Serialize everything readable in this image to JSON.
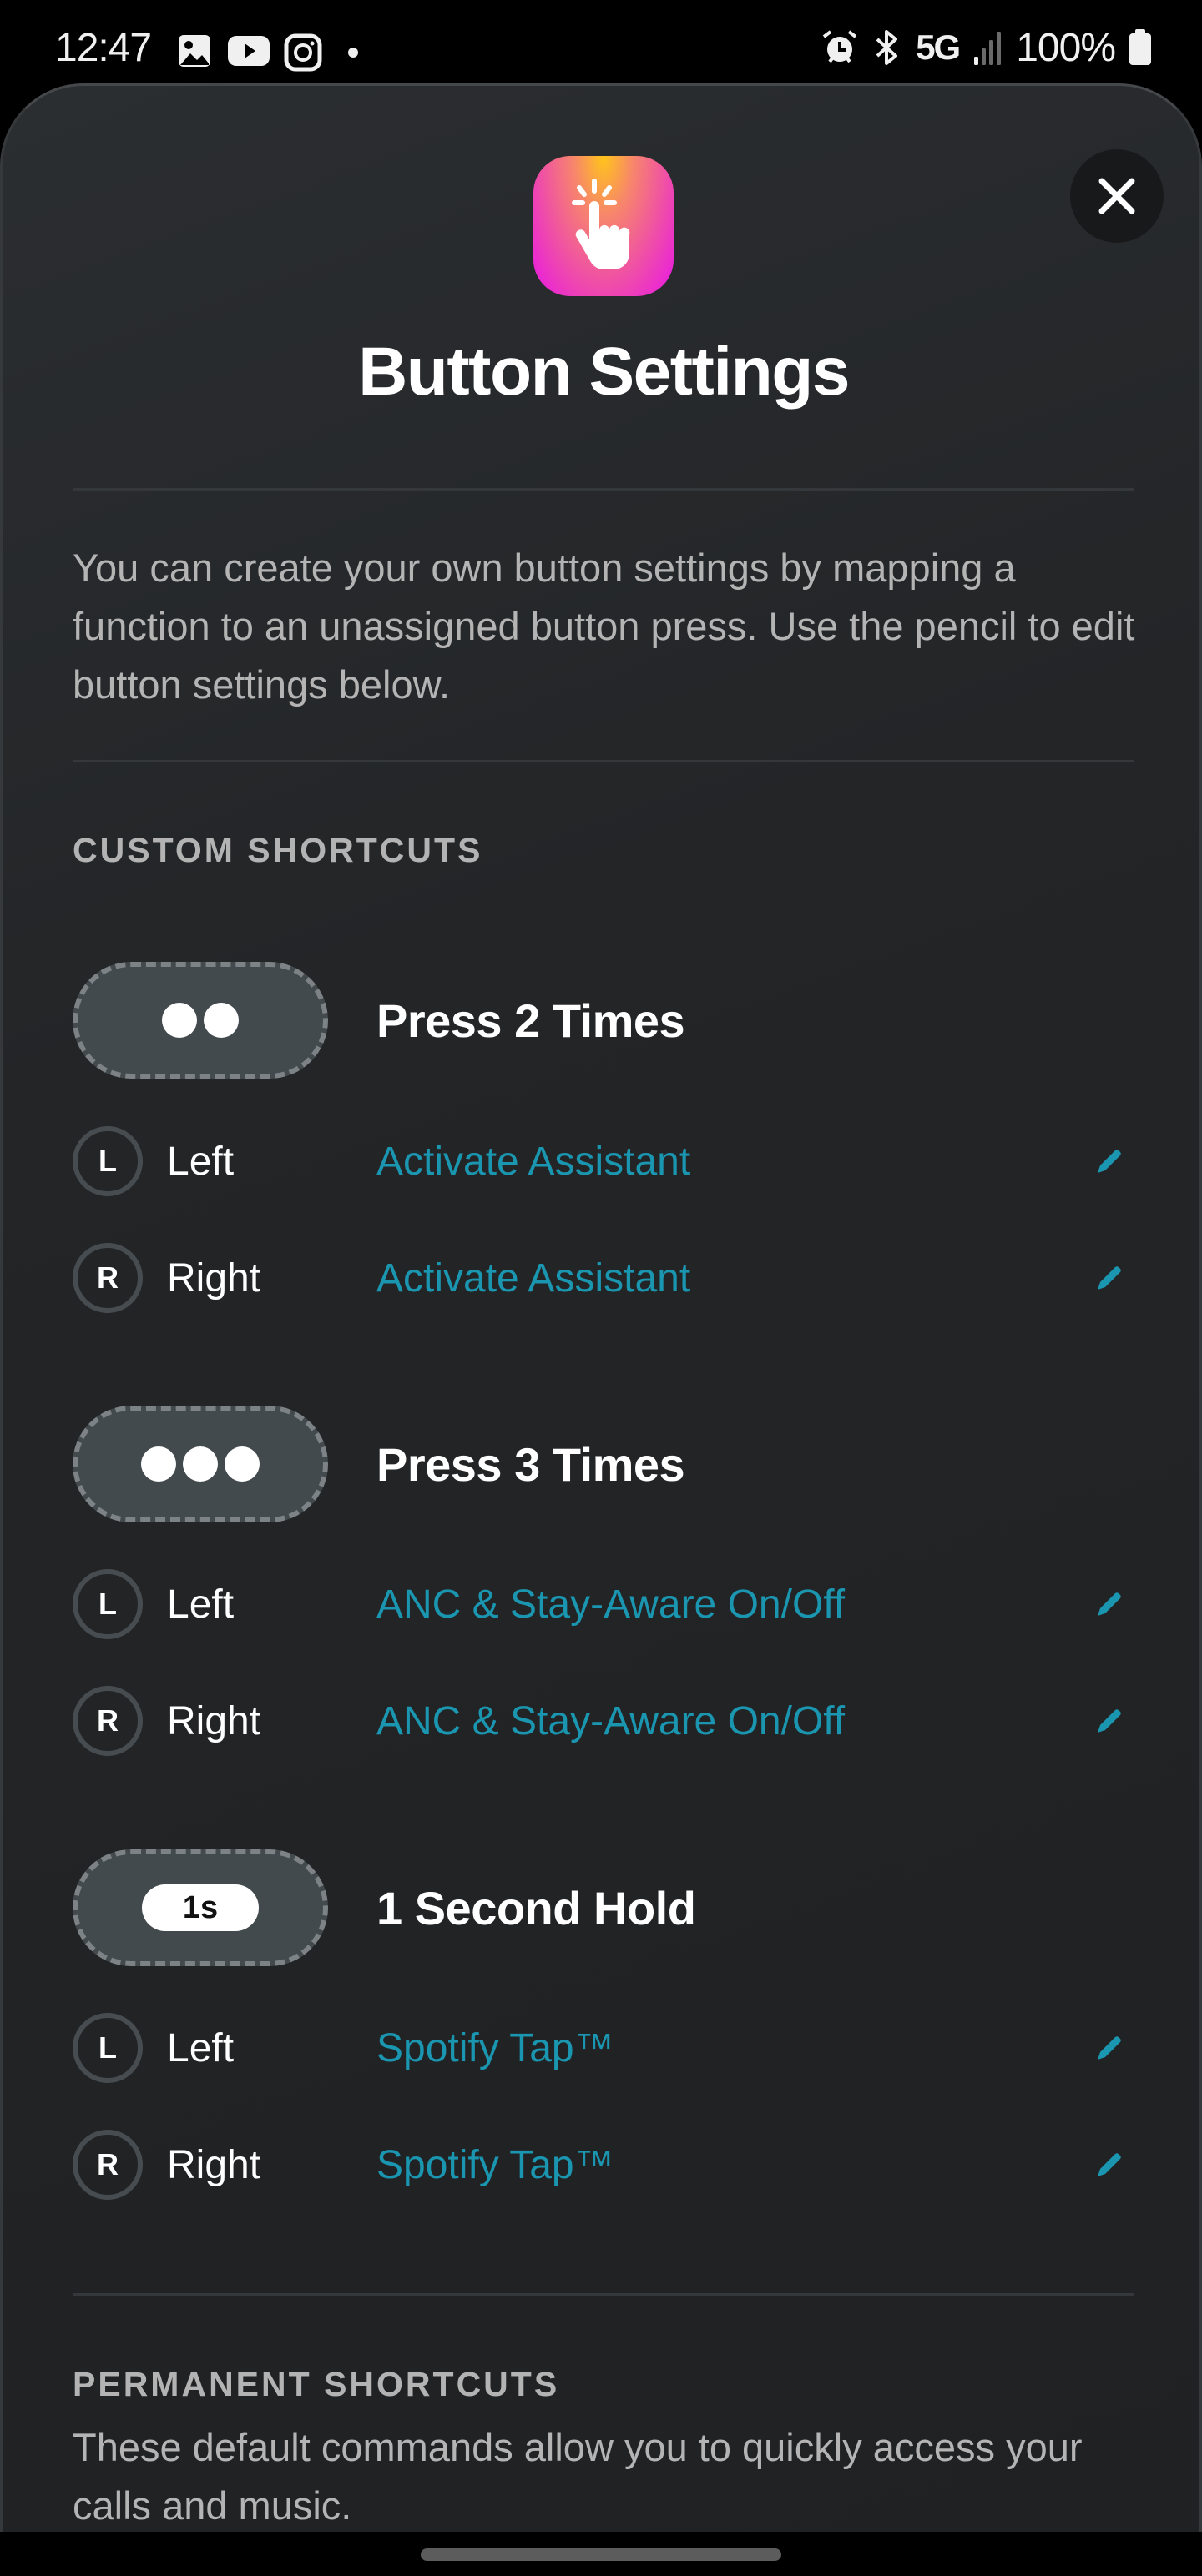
{
  "status_bar": {
    "time": "12:47",
    "left_icons": [
      "gallery-icon",
      "youtube-icon",
      "instagram-icon",
      "notification-dot-icon"
    ],
    "right_icons": [
      "alarm-icon",
      "bluetooth-icon"
    ],
    "network": "5G",
    "signal_bars_active": 1,
    "signal_bars_total": 4,
    "battery_percent": "100%"
  },
  "header": {
    "app_icon": "tap-hand-icon",
    "close_icon": "close-icon",
    "title": "Button Settings"
  },
  "intro": {
    "description": "You can create your own button settings by mapping a function to an unassigned button press. Use the pencil to edit button settings below."
  },
  "custom_shortcuts": {
    "heading": "CUSTOM SHORTCUTS",
    "groups": [
      {
        "title": "Press 2 Times",
        "indicator": "two-dots",
        "rows": [
          {
            "badge": "L",
            "side": "Left",
            "action": "Activate Assistant"
          },
          {
            "badge": "R",
            "side": "Right",
            "action": "Activate Assistant"
          }
        ]
      },
      {
        "title": "Press 3 Times",
        "indicator": "three-dots",
        "rows": [
          {
            "badge": "L",
            "side": "Left",
            "action": "ANC & Stay-Aware On/Off"
          },
          {
            "badge": "R",
            "side": "Right",
            "action": "ANC & Stay-Aware On/Off"
          }
        ]
      },
      {
        "title": "1 Second Hold",
        "indicator": "hold",
        "hold_label": "1s",
        "rows": [
          {
            "badge": "L",
            "side": "Left",
            "action": "Spotify Tap™"
          },
          {
            "badge": "R",
            "side": "Right",
            "action": "Spotify Tap™"
          }
        ]
      }
    ]
  },
  "permanent_shortcuts": {
    "heading": "PERMANENT SHORTCUTS",
    "description": "These default commands allow you to quickly access your calls and music."
  },
  "colors": {
    "accent": "#1b96b0",
    "background": "#222426",
    "secondary_text": "#b4b4b4",
    "icon_gradient_top": "#ffc51a",
    "icon_gradient_bottom": "#e817e6"
  }
}
